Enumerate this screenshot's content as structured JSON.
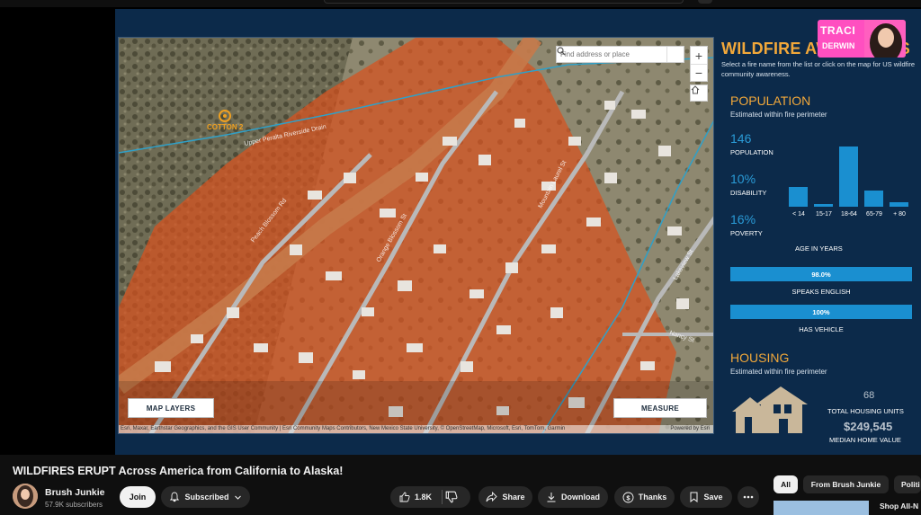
{
  "video": {
    "title": "WILDFIRES ERUPT Across America from California to Alaska!",
    "channel": "Brush Junkie",
    "subscribers": "57.9K subscribers",
    "join_label": "Join",
    "subscribed_label": "Subscribed",
    "likes": "1.8K",
    "share_label": "Share",
    "download_label": "Download",
    "thanks_label": "Thanks",
    "save_label": "Save"
  },
  "chips": [
    "All",
    "From Brush Junkie",
    "Politi"
  ],
  "recommended": {
    "title": "Shop All-N"
  },
  "logo": {
    "line1": "TRACI",
    "line2": "DERWIN"
  },
  "map": {
    "search_placeholder": "Find address or place",
    "zoom_in": "+",
    "zoom_out": "−",
    "map_layers_label": "MAP LAYERS",
    "measure_label": "MEASURE",
    "fire_label": "COTTON 2",
    "attribution": "Esri, Maxar, Earthstar Geographics, and the GIS User Community | Esri Community Maps Contributors, New Mexico State University, © OpenStreetMap, Microsoft, Esri, TomTom, Garmin",
    "powered_by": "Powered by Esri",
    "street_labels": [
      "Upper Peralta Riverside Drain",
      "Peach Blossom Rd",
      "Orange Blossom St",
      "Mountain Laurel St",
      "Lakeview St",
      "Nancy St"
    ],
    "colors": {
      "burn": "#d8521e",
      "road": "#b9b9b9",
      "canal": "#2fa0c8"
    }
  },
  "panel": {
    "title": "WILDFIRE AWARENESS",
    "subtitle": "Select a fire name from the list or click on the map for US wildfire community awareness.",
    "population_heading": "POPULATION",
    "population_sub": "Estimated within fire perimeter",
    "population_value": "146",
    "population_label": "POPULATION",
    "disability_value": "10%",
    "disability_label": "DISABILITY",
    "poverty_value": "16%",
    "poverty_label": "POVERTY",
    "age_axis": "AGE IN YEARS",
    "english_value": "98.0%",
    "english_label": "SPEAKS ENGLISH",
    "vehicle_value": "100%",
    "vehicle_label": "HAS VEHICLE",
    "housing_heading": "HOUSING",
    "housing_sub": "Estimated within fire perimeter",
    "housing_units_value": "68",
    "housing_units_label": "TOTAL HOUSING UNITS",
    "home_value": "$249,545",
    "home_value_label": "MEDIAN HOME VALUE",
    "colors": {
      "accent": "#f2a83a",
      "bar": "#1a8fd0",
      "bg": "#0c2a4a"
    }
  },
  "chart_data": {
    "type": "bar",
    "categories": [
      "< 14",
      "15-17",
      "18-64",
      "65-79",
      "+ 80"
    ],
    "values": [
      28,
      4,
      84,
      23,
      6
    ],
    "xlabel": "AGE IN YEARS",
    "ylabel": "",
    "ylim": [
      0,
      90
    ],
    "grid": false
  }
}
